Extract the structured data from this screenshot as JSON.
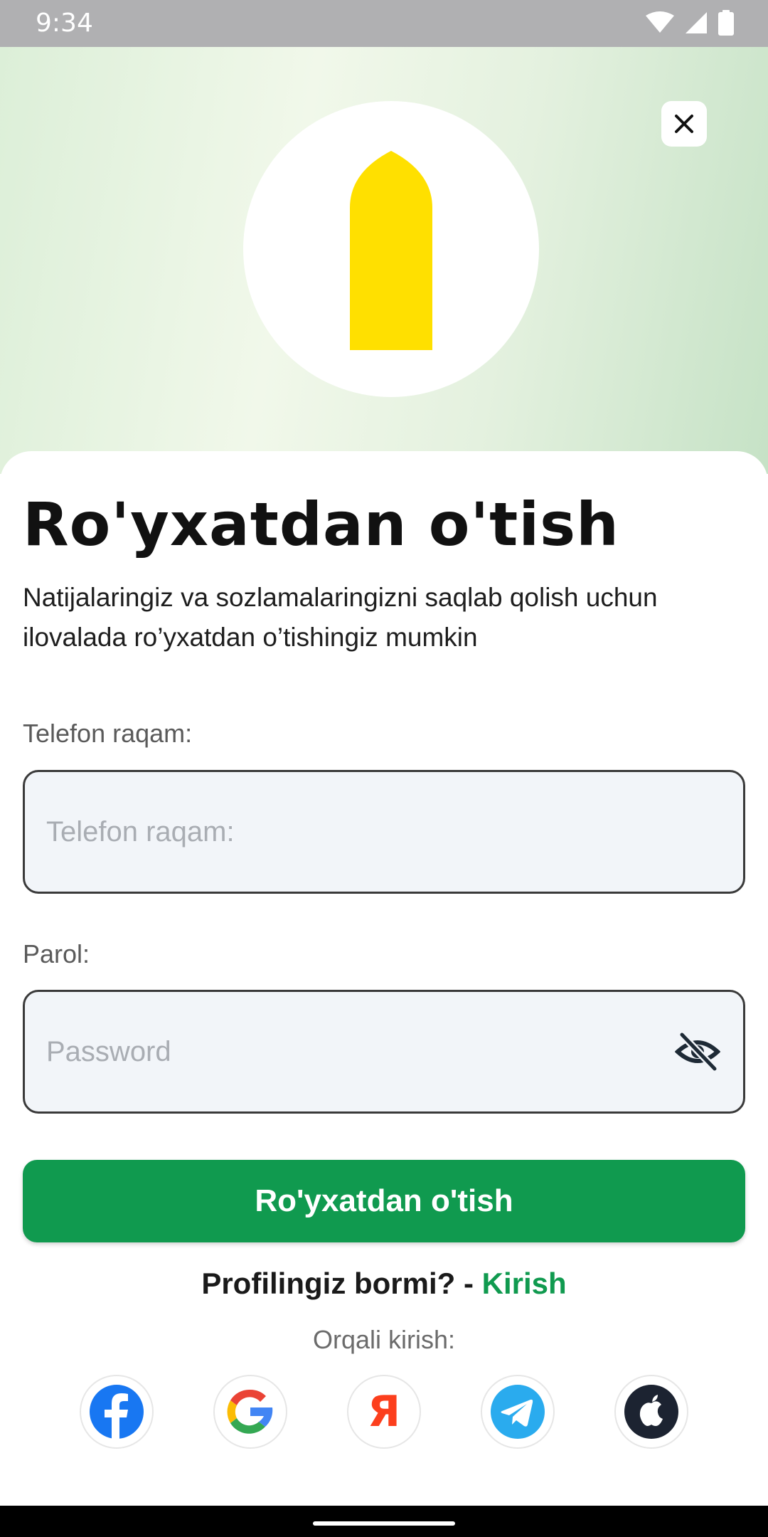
{
  "status_bar": {
    "time": "9:34"
  },
  "hero": {
    "close_icon": "close-icon",
    "logo_icon": "yellow-arch-logo"
  },
  "form": {
    "title": "Ro'yxatdan o'tish",
    "subtitle": "Natijalaringiz va sozlamalaringizni saqlab qolish uchun ilovalada ro’yxatdan o’tishingiz mumkin",
    "phone": {
      "label": "Telefon raqam:",
      "placeholder": "Telefon raqam:",
      "value": ""
    },
    "password": {
      "label": "Parol:",
      "placeholder": "Password",
      "value": "",
      "visibility_icon": "eye-off-icon"
    },
    "submit_label": "Ro'yxatdan o'tish",
    "login_prompt": "Profilingiz bormi? - ",
    "login_link": "Kirish",
    "social_label": "Orqali kirish:"
  },
  "social": [
    {
      "name": "facebook",
      "icon": "facebook-icon"
    },
    {
      "name": "google",
      "icon": "google-icon"
    },
    {
      "name": "yandex",
      "icon": "yandex-icon",
      "glyph": "Я"
    },
    {
      "name": "telegram",
      "icon": "telegram-icon"
    },
    {
      "name": "apple",
      "icon": "apple-icon"
    }
  ],
  "colors": {
    "accent": "#109a4f",
    "logo_yellow": "#ffe000",
    "input_bg": "#f2f5f9"
  }
}
